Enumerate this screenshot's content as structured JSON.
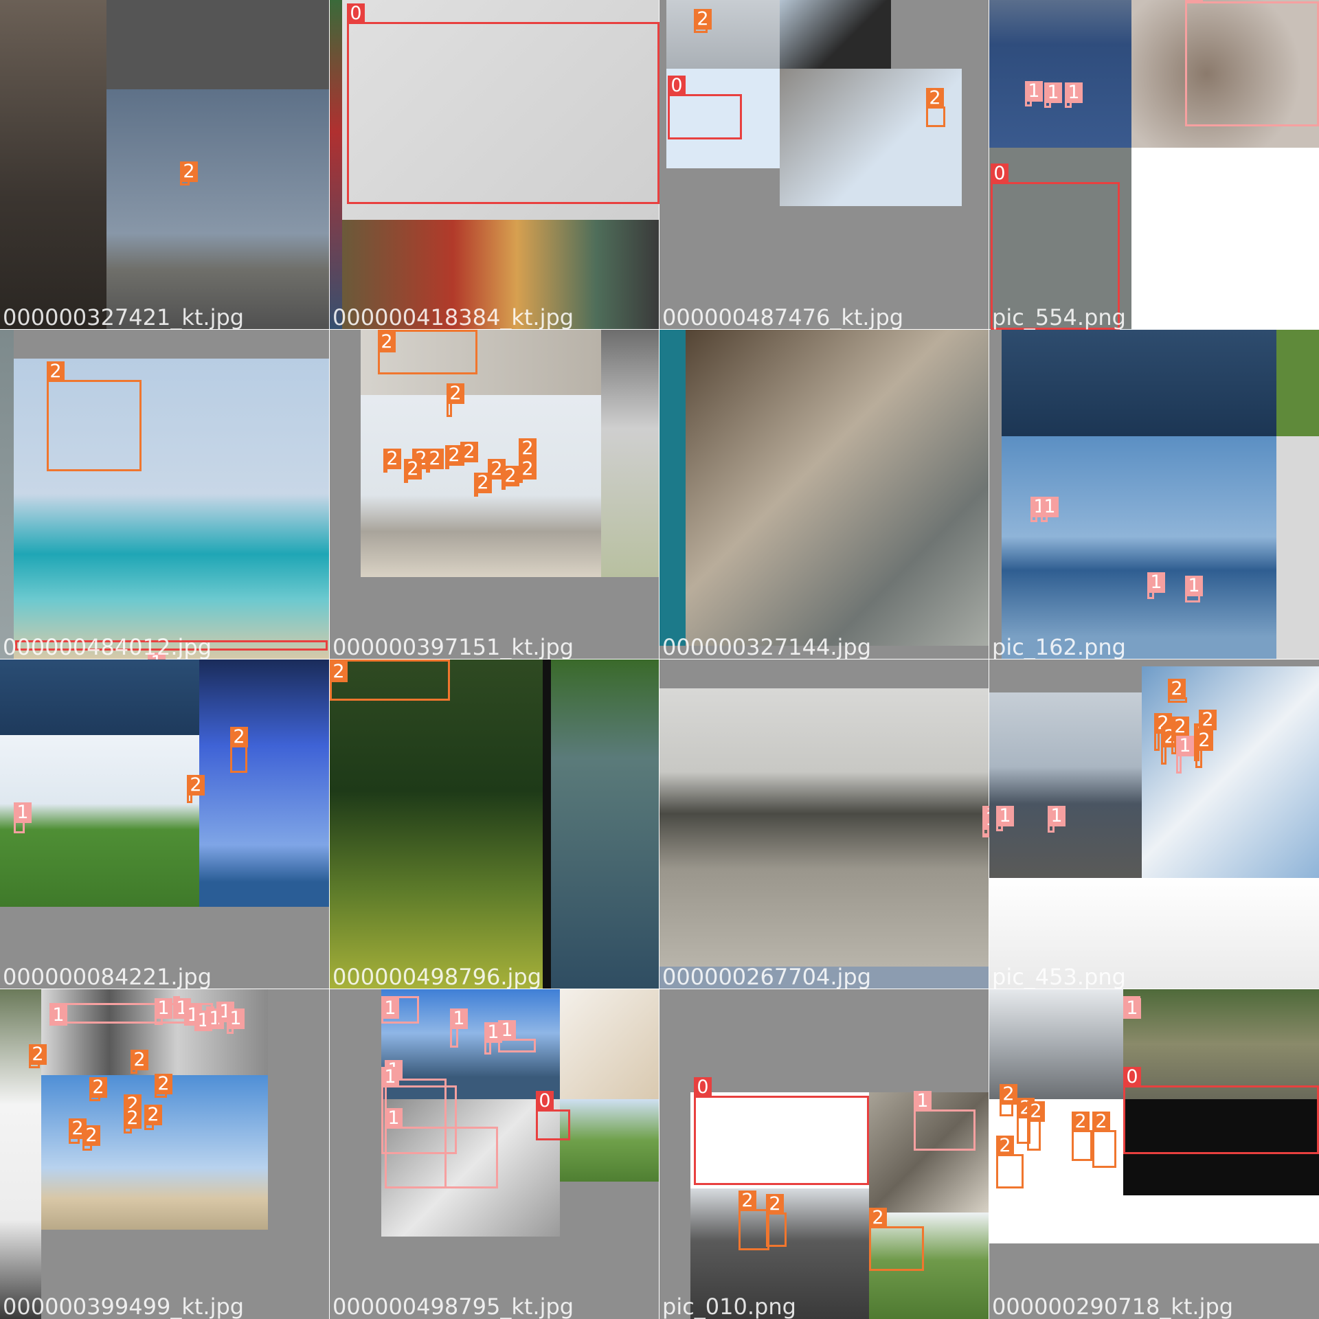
{
  "colors": {
    "class_0": "#e8403f",
    "class_1": "#f6a0a0",
    "class_2": "#f0762e",
    "tile_background": "#8e8e8e"
  },
  "tiles": [
    {
      "filename": "000000327421_kt.jpg",
      "labels": [
        "2"
      ]
    },
    {
      "filename": "000000418384_kt.jpg",
      "labels": [
        "0"
      ]
    },
    {
      "filename": "000000487476_kt.jpg",
      "labels": [
        "2",
        "0",
        "2"
      ]
    },
    {
      "filename": "pic_554.png",
      "labels": [
        "1",
        "1",
        "1",
        "1",
        "0"
      ]
    },
    {
      "filename": "000000484012.jpg",
      "labels": [
        "2",
        "1"
      ]
    },
    {
      "filename": "000000397151_kt.jpg",
      "labels": [
        "2",
        "2",
        "2",
        "2",
        "2",
        "2",
        "2",
        "2",
        "2",
        "2",
        "2",
        "2",
        "2"
      ]
    },
    {
      "filename": "000000327144.jpg",
      "labels": []
    },
    {
      "filename": "pic_162.png",
      "labels": [
        "1",
        "1",
        "1",
        "1"
      ]
    },
    {
      "filename": "000000084221.jpg",
      "labels": [
        "2",
        "2",
        "1"
      ]
    },
    {
      "filename": "000000498796.jpg",
      "labels": [
        "2"
      ]
    },
    {
      "filename": "000000267704.jpg",
      "labels": [
        "1",
        "1"
      ]
    },
    {
      "filename": "pic_453.png",
      "labels": [
        "2",
        "2",
        "2",
        "2",
        "2",
        "2",
        "2",
        "1",
        "1",
        "1"
      ]
    },
    {
      "filename": "000000399499_kt.jpg",
      "labels": [
        "1",
        "1",
        "1",
        "1",
        "1",
        "1",
        "1",
        "1",
        "2",
        "2",
        "2",
        "2",
        "2",
        "2",
        "2",
        "2",
        "2"
      ]
    },
    {
      "filename": "000000498795_kt.jpg",
      "labels": [
        "1",
        "1",
        "1",
        "1",
        "1",
        "1",
        "1",
        "0"
      ]
    },
    {
      "filename": "pic_010.png",
      "labels": [
        "0",
        "1",
        "2",
        "2",
        "2"
      ]
    },
    {
      "filename": "000000290718_kt.jpg",
      "labels": [
        "2",
        "1",
        "0",
        "2",
        "2",
        "2",
        "2",
        "2"
      ]
    }
  ]
}
